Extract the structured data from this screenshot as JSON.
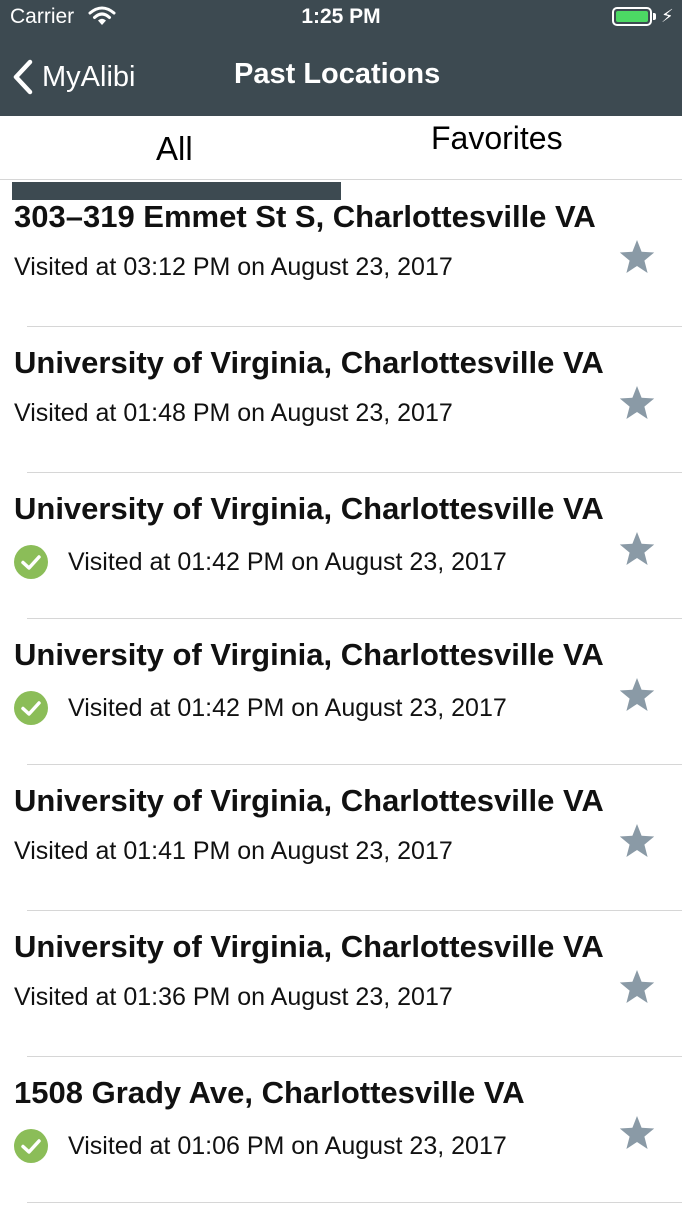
{
  "status_bar": {
    "carrier": "Carrier",
    "time": "1:25 PM"
  },
  "nav": {
    "back_label": "MyAlibi",
    "title": "Past Locations"
  },
  "tabs": [
    {
      "label": "All",
      "selected": true
    },
    {
      "label": "Favorites",
      "selected": false
    }
  ],
  "colors": {
    "nav_bar": "#3d4a51",
    "check": "#8bbd58",
    "star": "#8a9aa6",
    "battery": "#4cd964"
  },
  "locations": [
    {
      "title": "303–319 Emmet St S, Charlottesville VA",
      "visited": "Visited at 03:12 PM on August 23, 2017",
      "checked": false
    },
    {
      "title": "University of Virginia, Charlottesville VA",
      "visited": "Visited at 01:48 PM on August 23, 2017",
      "checked": false
    },
    {
      "title": "University of Virginia, Charlottesville VA",
      "visited": "Visited at 01:42 PM on August 23, 2017",
      "checked": true
    },
    {
      "title": "University of Virginia, Charlottesville VA",
      "visited": "Visited at 01:42 PM on August 23, 2017",
      "checked": true
    },
    {
      "title": "University of Virginia, Charlottesville VA",
      "visited": "Visited at 01:41 PM on August 23, 2017",
      "checked": false
    },
    {
      "title": "University of Virginia, Charlottesville VA",
      "visited": "Visited at 01:36 PM on August 23, 2017",
      "checked": false
    },
    {
      "title": "1508 Grady Ave, Charlottesville VA",
      "visited": "Visited at 01:06 PM on August 23, 2017",
      "checked": true
    }
  ]
}
